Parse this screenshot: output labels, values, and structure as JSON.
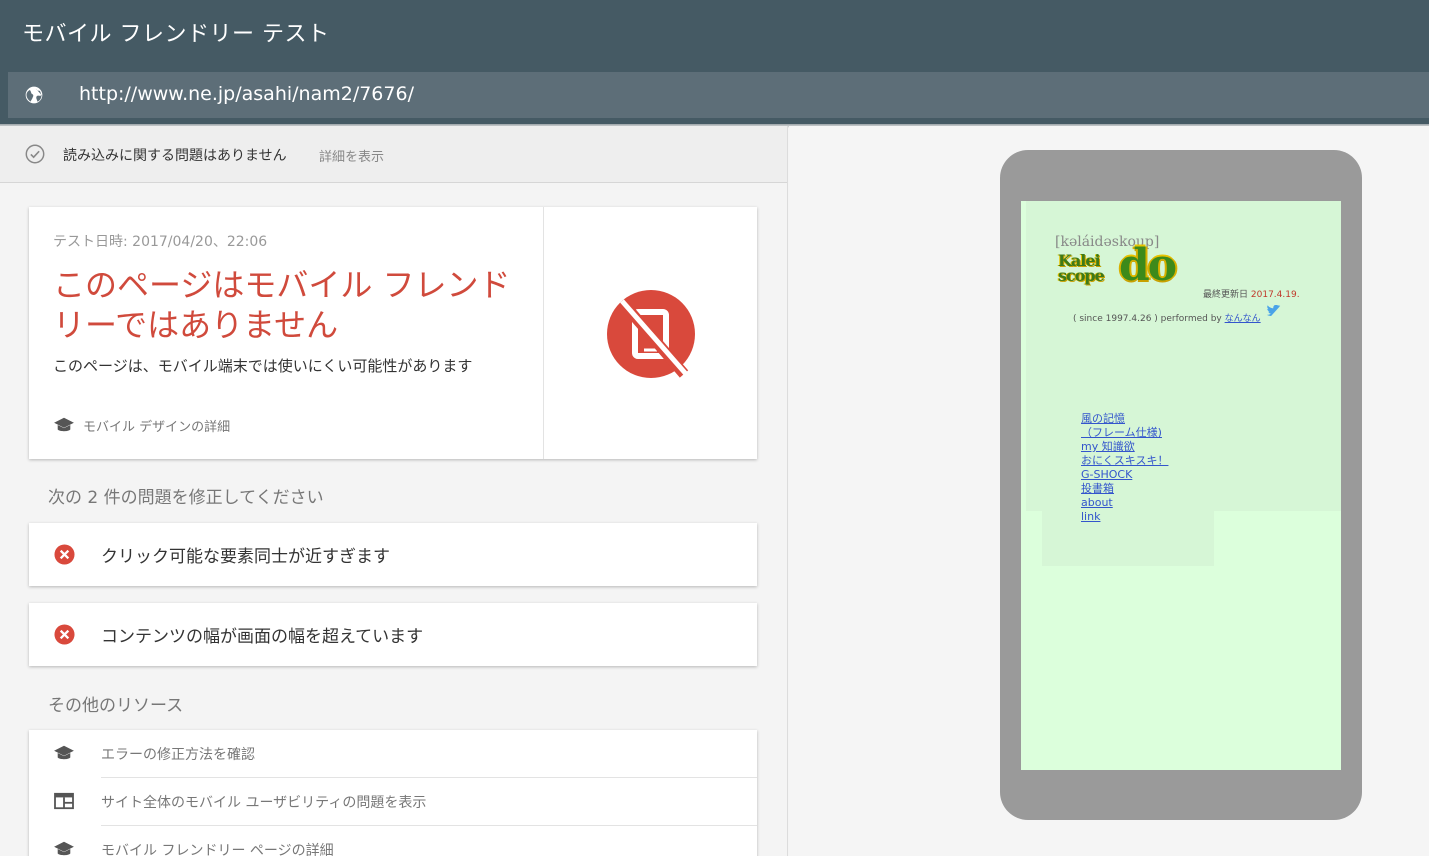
{
  "header": {
    "title": "モバイル フレンドリー テスト"
  },
  "urlbar": {
    "url": "http://www.ne.jp/asahi/nam2/7676/"
  },
  "status": {
    "text": "読み込みに関する問題はありません",
    "details_link": "詳細を表示"
  },
  "result": {
    "test_date": "テスト日時: 2017/04/20、22:06",
    "verdict": "このページはモバイル フレンドリーではありません",
    "subtitle": "このページは、モバイル端末では使いにくい可能性があります",
    "design_link": "モバイル デザインの詳細",
    "verdict_color": "#d04a3c"
  },
  "issues": {
    "heading": "次の 2 件の問題を修正してください",
    "items": [
      {
        "text": "クリック可能な要素同士が近すぎます"
      },
      {
        "text": "コンテンツの幅が画面の幅を超えています"
      }
    ]
  },
  "resources": {
    "heading": "その他のリソース",
    "items": [
      {
        "text": "エラーの修正方法を確認",
        "icon": "graduation-cap-icon"
      },
      {
        "text": "サイト全体のモバイル ユーザビリティの問題を表示",
        "icon": "window-layout-icon"
      },
      {
        "text": "モバイル フレンドリー ページの詳細",
        "icon": "graduation-cap-icon"
      }
    ]
  },
  "preview": {
    "pronunciation": "[kəláidəskoup]",
    "logo_kalei": "Kalei",
    "logo_scope": "scope",
    "logo_do": "do",
    "updated_label": "最終更新日",
    "updated_date": "2017.4.19.",
    "since_text": "( since 1997.4.26 ) performed by",
    "author": "なんなん",
    "links": [
      "風の記憶",
      "（フレーム仕様)",
      "my 知識欲",
      "おにくスキスキ！",
      "G-SHOCK",
      "投書箱",
      "about",
      "link"
    ]
  },
  "colors": {
    "header_bg": "#455a64",
    "error_red": "#d9493c",
    "preview_bg": "#dcffdc"
  }
}
